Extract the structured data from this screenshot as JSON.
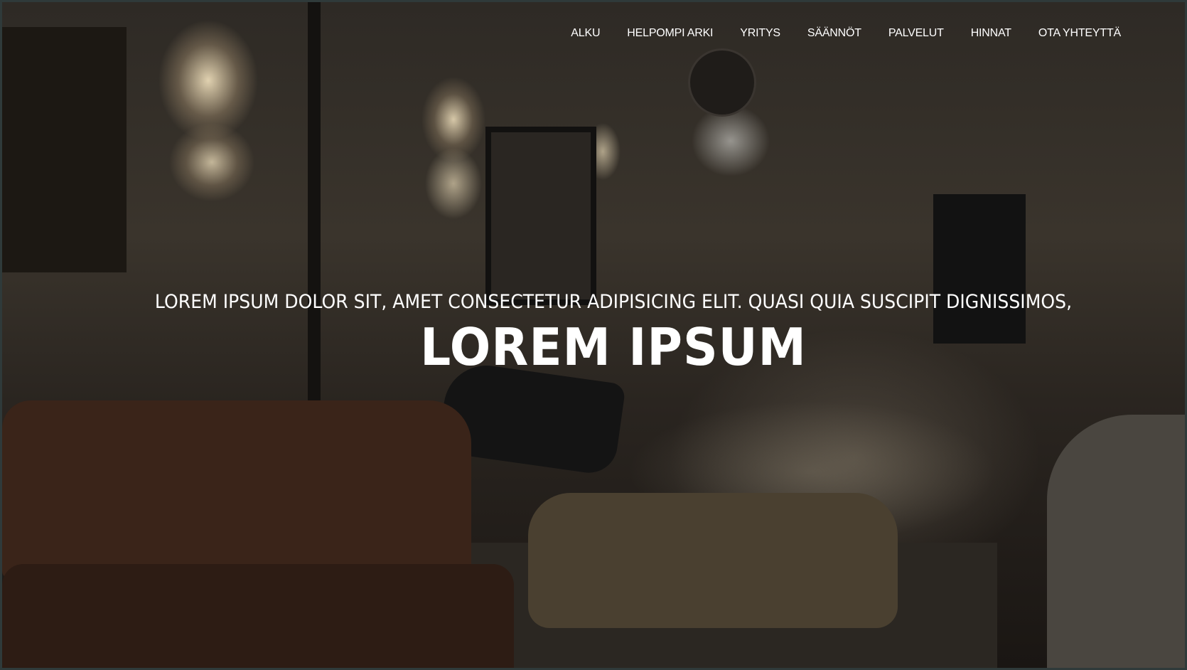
{
  "nav": {
    "items": [
      {
        "label": "ALKU"
      },
      {
        "label": "HELPOMPI ARKI"
      },
      {
        "label": "YRITYS"
      },
      {
        "label": "SÄÄNNÖT"
      },
      {
        "label": "PALVELUT"
      },
      {
        "label": "HINNAT"
      },
      {
        "label": "OTA YHTEYTTÄ"
      }
    ]
  },
  "hero": {
    "subtitle": "LOREM IPSUM DOLOR SIT, AMET CONSECTETUR ADIPISICING ELIT. QUASI QUIA SUSCIPIT DIGNISSIMOS,",
    "title": "LOREM IPSUM"
  },
  "colors": {
    "text": "#ffffff",
    "frame": "#2f3a3a"
  }
}
